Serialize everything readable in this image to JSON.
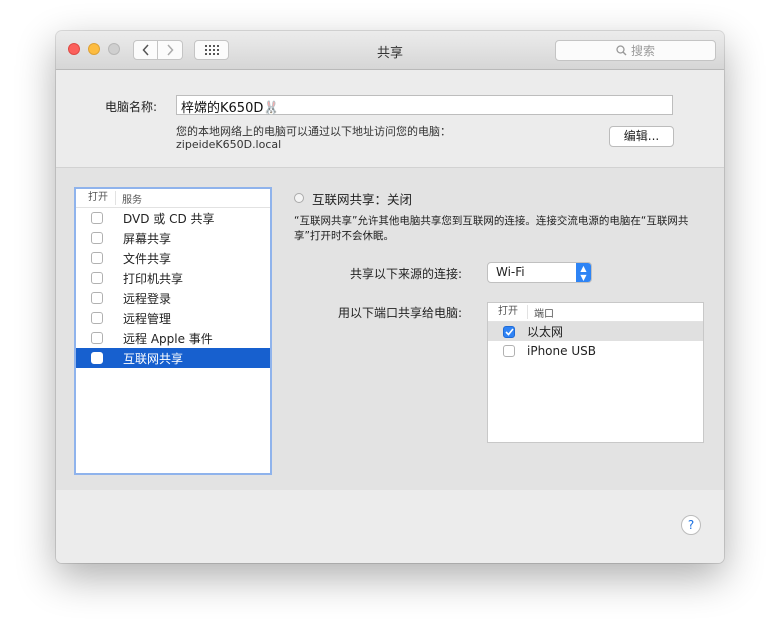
{
  "window": {
    "title": "共享",
    "search_placeholder": "搜索"
  },
  "toolbar": {
    "back_icon": "chevron-left-icon",
    "forward_icon": "chevron-right-icon",
    "grid_icon": "grid-icon"
  },
  "computer": {
    "name_label": "电脑名称:",
    "name_value": "梓嫦的K650D🐰",
    "address_note": "您的本地网络上的电脑可以通过以下地址访问您的电脑：",
    "address": "zipeideK650D.local",
    "edit_button": "编辑..."
  },
  "services": {
    "header_on": "打开",
    "header_service": "服务",
    "items": [
      {
        "label": "DVD 或 CD 共享",
        "checked": false,
        "selected": false
      },
      {
        "label": "屏幕共享",
        "checked": false,
        "selected": false
      },
      {
        "label": "文件共享",
        "checked": false,
        "selected": false
      },
      {
        "label": "打印机共享",
        "checked": false,
        "selected": false
      },
      {
        "label": "远程登录",
        "checked": false,
        "selected": false
      },
      {
        "label": "远程管理",
        "checked": false,
        "selected": false
      },
      {
        "label": "远程 Apple 事件",
        "checked": false,
        "selected": false
      },
      {
        "label": "互联网共享",
        "checked": false,
        "selected": true
      }
    ]
  },
  "detail": {
    "status": "互联网共享：关闭",
    "description": "“互联网共享”允许其他电脑共享您到互联网的连接。连接交流电源的电脑在“互联网共享”打开时不会休眠。",
    "share_from_label": "共享以下来源的连接:",
    "share_from_value": "Wi-Fi",
    "ports_label": "用以下端口共享给电脑:",
    "ports_header_on": "打开",
    "ports_header_port": "端口",
    "ports": [
      {
        "label": "以太网",
        "checked": true
      },
      {
        "label": "iPhone USB",
        "checked": false
      }
    ]
  },
  "help_label": "?",
  "colors": {
    "selection": "#1760cf",
    "accent": "#2e84f5"
  }
}
